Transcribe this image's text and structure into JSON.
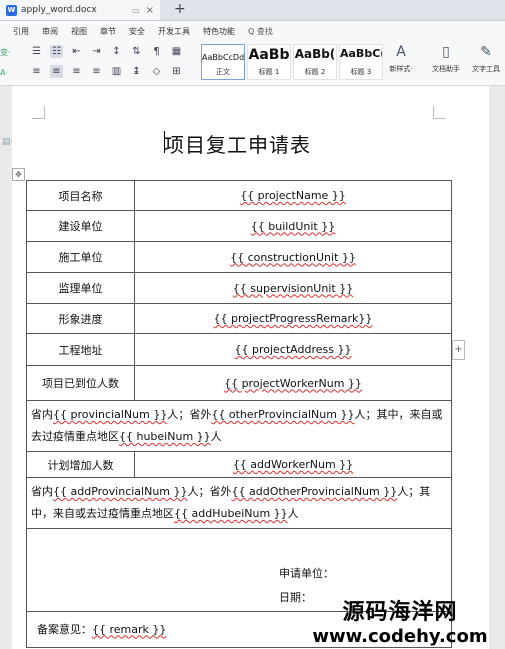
{
  "tab": {
    "filename": "apply_word.docx",
    "close": "×",
    "pin": "▭",
    "new": "+"
  },
  "menu": [
    "引用",
    "审阅",
    "视图",
    "章节",
    "安全",
    "开发工具",
    "特色功能",
    "Q 查找"
  ],
  "ribbon": {
    "styles": [
      {
        "preview": "AaBbCcDd",
        "name": "正文"
      },
      {
        "preview": "AaBb",
        "name": "标题 1"
      },
      {
        "preview": "AaBb(",
        "name": "标题 2"
      },
      {
        "preview": "AaBbC(",
        "name": "标题 3"
      }
    ],
    "new_style": "新样式·",
    "doc_helper": "文档助手",
    "text_tools": "文字工具",
    "left_glyphs": [
      "变·",
      "A·"
    ]
  },
  "document": {
    "title": "项目复工申请表",
    "rows": [
      {
        "label": "项目名称",
        "value": "{{ projectName }}"
      },
      {
        "label": "建设单位",
        "value": "{{ buildUnit }}"
      },
      {
        "label": "施工单位",
        "value": "{{ constructionUnit }}"
      },
      {
        "label": "监理单位",
        "value": "{{ supervisionUnit }}"
      },
      {
        "label": "形象进度",
        "value": "{{ projectProgressRemark}}"
      },
      {
        "label": "工程地址",
        "value": "{{ projectAddress }}"
      },
      {
        "label": "项目已到位人数",
        "value": "{{ projectWorkerNum }}"
      }
    ],
    "arrived_detail": {
      "p1": "省内",
      "v1": "{{ provincialNum }}",
      "p2": "人；省外",
      "v2": "{{ otherProvincialNum }}",
      "p3": "人；其中，来自或去过疫情重点地区",
      "v3": "{{ hubeiNum }}",
      "p4": "人"
    },
    "plan_row": {
      "label": "计划增加人数",
      "value": "{{ addWorkerNum }}"
    },
    "plan_detail": {
      "p1": "省内",
      "v1": "{{ addProvincialNum }}",
      "p2": "人；省外",
      "v2": "{{ addOtherProvincialNum }}",
      "p3": "人；其中，来自或去过疫情重点地区",
      "v3": "{{ addHubeiNum }}",
      "p4": "人"
    },
    "sign_unit": "申请单位：",
    "sign_date": "日期：",
    "remark_label": "备案意见：",
    "remark_value": "{{ remark }}"
  },
  "watermark": {
    "line1": "源码海洋网",
    "line2": "www.codehy.com"
  }
}
